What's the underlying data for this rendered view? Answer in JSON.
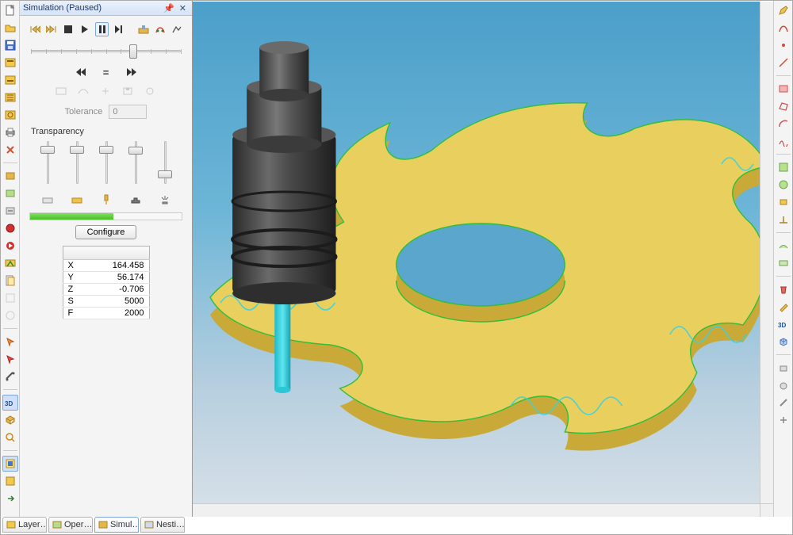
{
  "panel": {
    "title": "Simulation (Paused)",
    "tolerance_label": "Tolerance",
    "tolerance_value": "0",
    "transparency_label": "Transparency",
    "configure_label": "Configure",
    "progress_percent": 55,
    "speed_slider_percent": 68,
    "transparency_sliders": [
      80,
      80,
      80,
      78,
      22
    ]
  },
  "coords": {
    "rows": [
      {
        "k": "X",
        "v": "164.458"
      },
      {
        "k": "Y",
        "v": "56.174"
      },
      {
        "k": "Z",
        "v": "-0.706"
      },
      {
        "k": "S",
        "v": "5000"
      },
      {
        "k": "F",
        "v": "2000"
      }
    ]
  },
  "tabs": {
    "items": [
      {
        "label": "Layer…",
        "active": false
      },
      {
        "label": "Oper…",
        "active": false
      },
      {
        "label": "Simul…",
        "active": true
      },
      {
        "label": "Nesti…",
        "active": false
      }
    ]
  },
  "left_tools": [
    "new",
    "open",
    "save",
    "import",
    "export",
    "undo",
    "redo",
    "cut",
    "copy",
    "paste",
    "print",
    "sep",
    "op1",
    "op2",
    "op3",
    "stop",
    "run",
    "sep",
    "toolpaths",
    "simulate",
    "sep",
    "select",
    "deselect",
    "measure",
    "sep",
    "view3d",
    "viewiso",
    "fit",
    "sep",
    "layers",
    "layers2",
    "sep",
    "arrow"
  ],
  "right_tools": [
    "r1",
    "r2",
    "r3",
    "r4",
    "r5",
    "r6",
    "r7",
    "r8",
    "r9",
    "r10",
    "r11",
    "r12",
    "r13",
    "r14",
    "r15",
    "r16",
    "r17",
    "r18",
    "r19",
    "r20",
    "r21",
    "r22",
    "r23",
    "r24",
    "r25"
  ]
}
